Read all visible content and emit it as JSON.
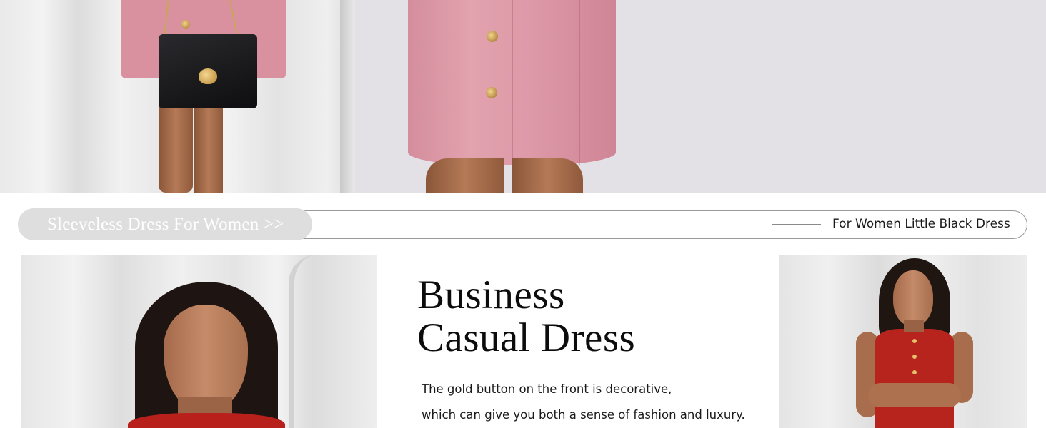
{
  "nav": {
    "left_pill_label": "Sleeveless Dress For Women >>",
    "right_link_label": "For Women Little Black Dress"
  },
  "feature": {
    "headline_line1": "Business",
    "headline_line2": "Casual Dress",
    "description_line1": "The gold button on the front is decorative,",
    "description_line2": "which can give you both a sense of fashion and luxury."
  },
  "colors": {
    "pill_background": "#dedede",
    "dress_pink": "#d9909f",
    "dress_red": "#b8201b",
    "gold_button": "#e6c06c"
  }
}
